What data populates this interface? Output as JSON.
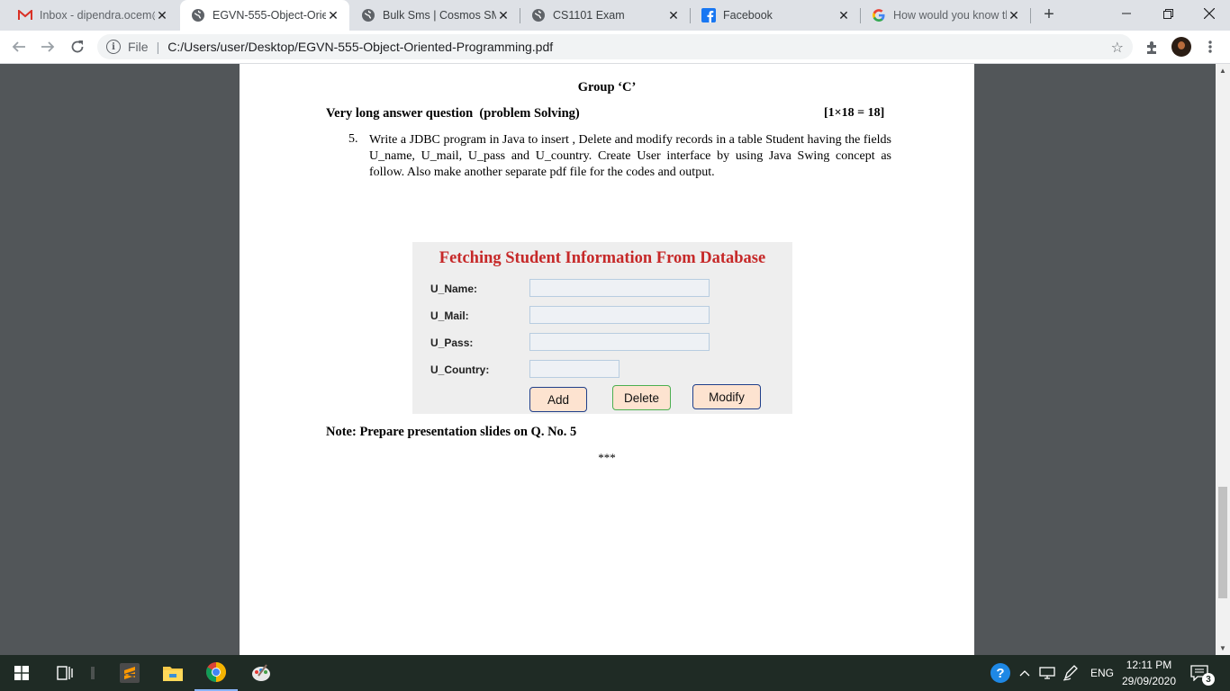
{
  "browser": {
    "tabs": [
      {
        "title": "Inbox - dipendra.ocem@",
        "icon": "gmail-icon",
        "active": false
      },
      {
        "title": "EGVN-555-Object-Orie",
        "icon": "globe-icon",
        "active": true
      },
      {
        "title": "Bulk Sms | Cosmos SMS",
        "icon": "globe-icon",
        "active": false
      },
      {
        "title": "CS1101 Exam",
        "icon": "globe-icon",
        "active": false
      },
      {
        "title": "Facebook",
        "icon": "facebook-icon",
        "active": false
      },
      {
        "title": "How would you know th",
        "icon": "google-icon",
        "active": false
      }
    ],
    "new_tab_symbol": "+",
    "address": {
      "scheme_label": "File",
      "separator": "|",
      "url": "C:/Users/user/Desktop/EGVN-555-Object-Oriented-Programming.pdf"
    }
  },
  "document": {
    "group_title": "Group ‘C’",
    "question_heading": "Very long answer question  (problem Solving)",
    "marks": "[1×18 = 18]",
    "question_number": "5.",
    "question_text": "Write a JDBC program in Java to insert , Delete and modify records in a table Student having the fields U_name, U_mail, U_pass and U_country. Create User interface by using Java Swing concept as follow. Also make another separate pdf file for the codes and output.",
    "form_image": {
      "title": "Fetching Student Information From Database",
      "fields": [
        {
          "label": "U_Name:",
          "value": ""
        },
        {
          "label": "U_Mail:",
          "value": ""
        },
        {
          "label": "U_Pass:",
          "value": ""
        },
        {
          "label": "U_Country:",
          "value": ""
        }
      ],
      "buttons": {
        "add": "Add",
        "delete": "Delete",
        "modify": "Modify"
      },
      "colors": {
        "title": "#c62828",
        "add_bg": "#fde3d0",
        "delete_bg": "#fde3d0",
        "modify_bg": "#fde3d0",
        "add_border": "#1f3f8a",
        "delete_border": "#4caf50",
        "modify_border": "#1f3f8a"
      }
    },
    "note": "Note: Prepare presentation slides on Q. No. 5",
    "end_marker": "***"
  },
  "taskbar": {
    "tray": {
      "language": "ENG",
      "time": "12:11 PM",
      "date": "29/09/2020",
      "notifications": "3"
    }
  }
}
